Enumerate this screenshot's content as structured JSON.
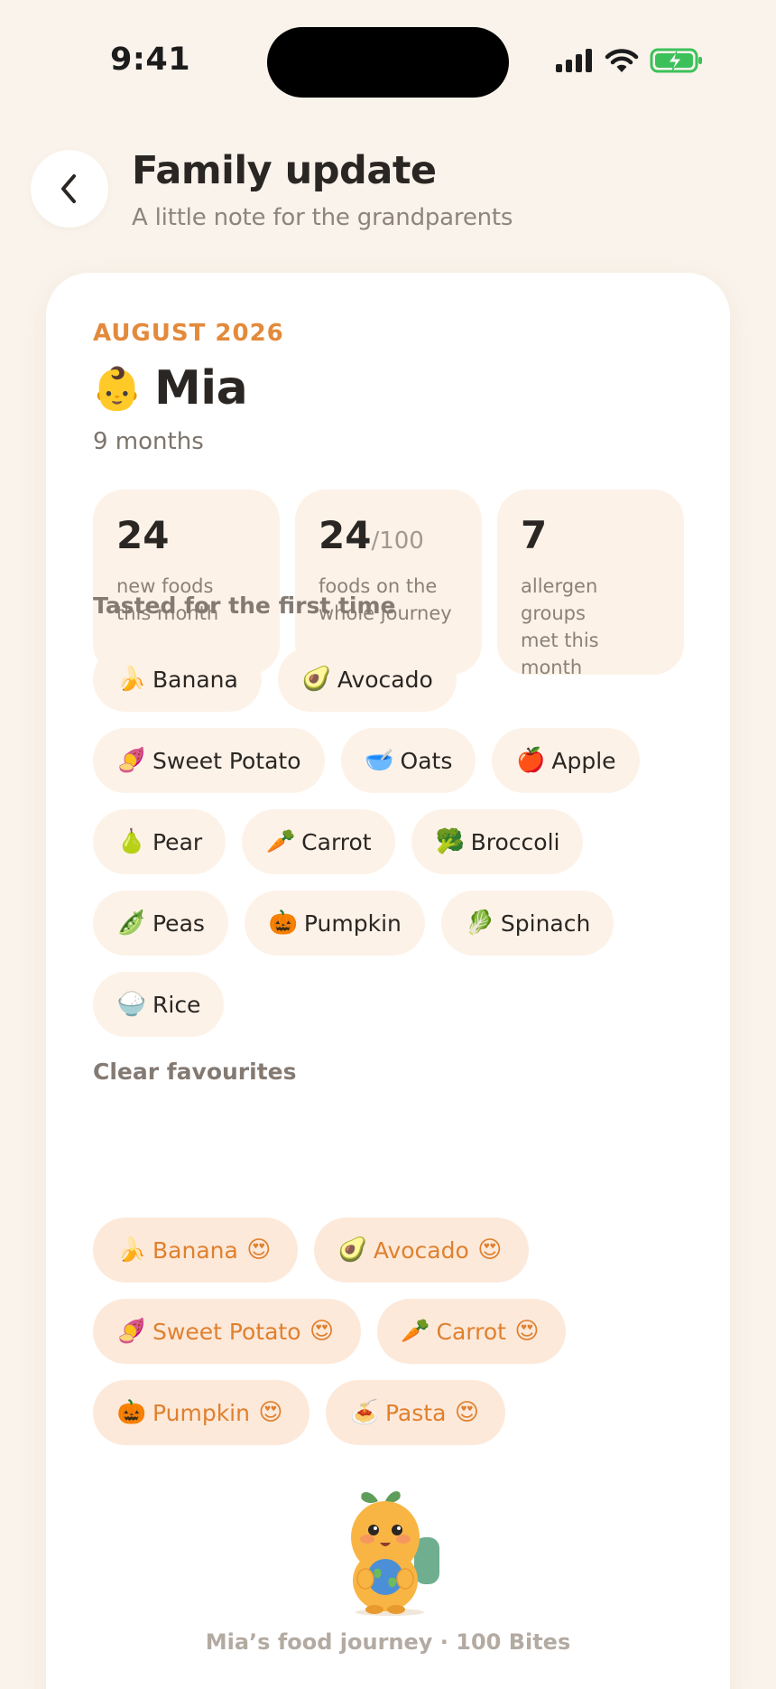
{
  "status_bar": {
    "time": "9:41"
  },
  "header": {
    "title": "Family update",
    "subtitle": "A little note for the grandparents"
  },
  "card": {
    "month": "AUGUST 2026",
    "child_emoji": "👶",
    "child_name": "Mia",
    "age": "9 months",
    "stats": [
      {
        "value": "24",
        "denominator": "",
        "label": "new foods\nthis month"
      },
      {
        "value": "24",
        "denominator": "/100",
        "label": "foods on the\nwhole journey"
      },
      {
        "value": "7",
        "denominator": "",
        "label": "allergen\ngroups\nmet this month"
      }
    ],
    "first_time_title": "Tasted for the first time",
    "first_time_foods": [
      {
        "emoji": "🍌",
        "name": "Banana"
      },
      {
        "emoji": "🥑",
        "name": "Avocado"
      },
      {
        "emoji": "🍠",
        "name": "Sweet Potato"
      },
      {
        "emoji": "🥣",
        "name": "Oats"
      },
      {
        "emoji": "🍎",
        "name": "Apple"
      },
      {
        "emoji": "🍐",
        "name": "Pear"
      },
      {
        "emoji": "🥕",
        "name": "Carrot"
      },
      {
        "emoji": "🥦",
        "name": "Broccoli"
      },
      {
        "emoji": "🫛",
        "name": "Peas"
      },
      {
        "emoji": "🎃",
        "name": "Pumpkin"
      },
      {
        "emoji": "🥬",
        "name": "Spinach"
      },
      {
        "emoji": "🍚",
        "name": "Rice"
      }
    ],
    "favourites_title": "Clear favourites",
    "favourites": [
      {
        "emoji": "🍌",
        "name": "Banana",
        "reaction": "😍"
      },
      {
        "emoji": "🥑",
        "name": "Avocado",
        "reaction": "😍"
      },
      {
        "emoji": "🍠",
        "name": "Sweet Potato",
        "reaction": "😍"
      },
      {
        "emoji": "🥕",
        "name": "Carrot",
        "reaction": "😍"
      },
      {
        "emoji": "🎃",
        "name": "Pumpkin",
        "reaction": "😍"
      },
      {
        "emoji": "🍝",
        "name": "Pasta",
        "reaction": "😍"
      }
    ],
    "footer": "Mia’s food journey · 100 Bites"
  },
  "colors": {
    "background": "#FAF3EB",
    "accent": "#E38A3B",
    "chip": "#FDF2E8",
    "favourite_chip": "#FDE9DA"
  }
}
